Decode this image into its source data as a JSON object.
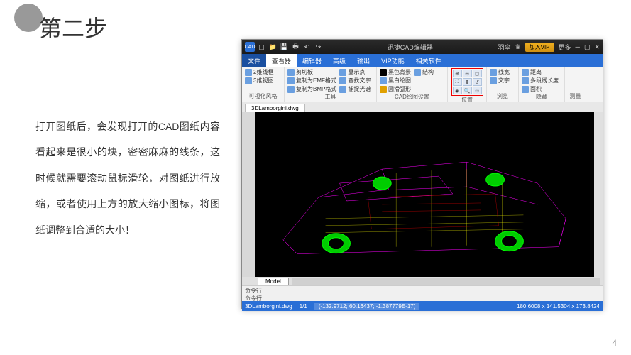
{
  "slide": {
    "step_title": "第二步",
    "page_number": "4",
    "body_text": "打开图纸后，会发现打开的CAD图纸内容看起来是很小的块，密密麻麻的线条，这时候就需要滚动鼠标滑轮，对图纸进行放缩，或者使用上方的放大缩小图标，将图纸调整到合适的大小！"
  },
  "window": {
    "app_name": "迅捷CAD编辑器",
    "logo_text": "CAD",
    "user_info": "羽伞",
    "vip_button": "加入VIP",
    "more_label": "更多"
  },
  "menu": {
    "tabs": [
      "文件",
      "查看器",
      "编辑器",
      "高级",
      "输出",
      "VIP功能",
      "相关软件"
    ],
    "active_index": 1
  },
  "ribbon": {
    "groups": {
      "visual": {
        "label": "可视化风格",
        "items": [
          "2维线框",
          "3维视图"
        ]
      },
      "tools": {
        "label": "工具",
        "items": [
          "剪切板",
          "复制为EMF格式",
          "复制为BMP格式",
          "显示点",
          "查找文字",
          "捕捉光谱"
        ]
      },
      "settings": {
        "label": "CAD绘图设置",
        "items": [
          "黑色背景",
          "黑白绘图",
          "圆滑弧形",
          "结构"
        ]
      },
      "position": {
        "label": "位置"
      },
      "browse": {
        "label": "浏览",
        "items": [
          "线宽",
          "文字"
        ]
      },
      "hide": {
        "label": "隐藏",
        "items": [
          "距离",
          "多段线长度",
          "面积"
        ]
      },
      "measure": {
        "label": "测量"
      }
    }
  },
  "doc_tab": "3DLamborgini.dwg",
  "model_tab": "Model",
  "command": {
    "prompt": "命令行",
    "secondary": "命令行"
  },
  "status": {
    "file": "3DLamborgini.dwg",
    "ratio": "1/1",
    "coords": "(-132.9712; 60.16437; -1.387779E-17)",
    "extents": "180.6008 x 141.5304 x 173.8424"
  }
}
